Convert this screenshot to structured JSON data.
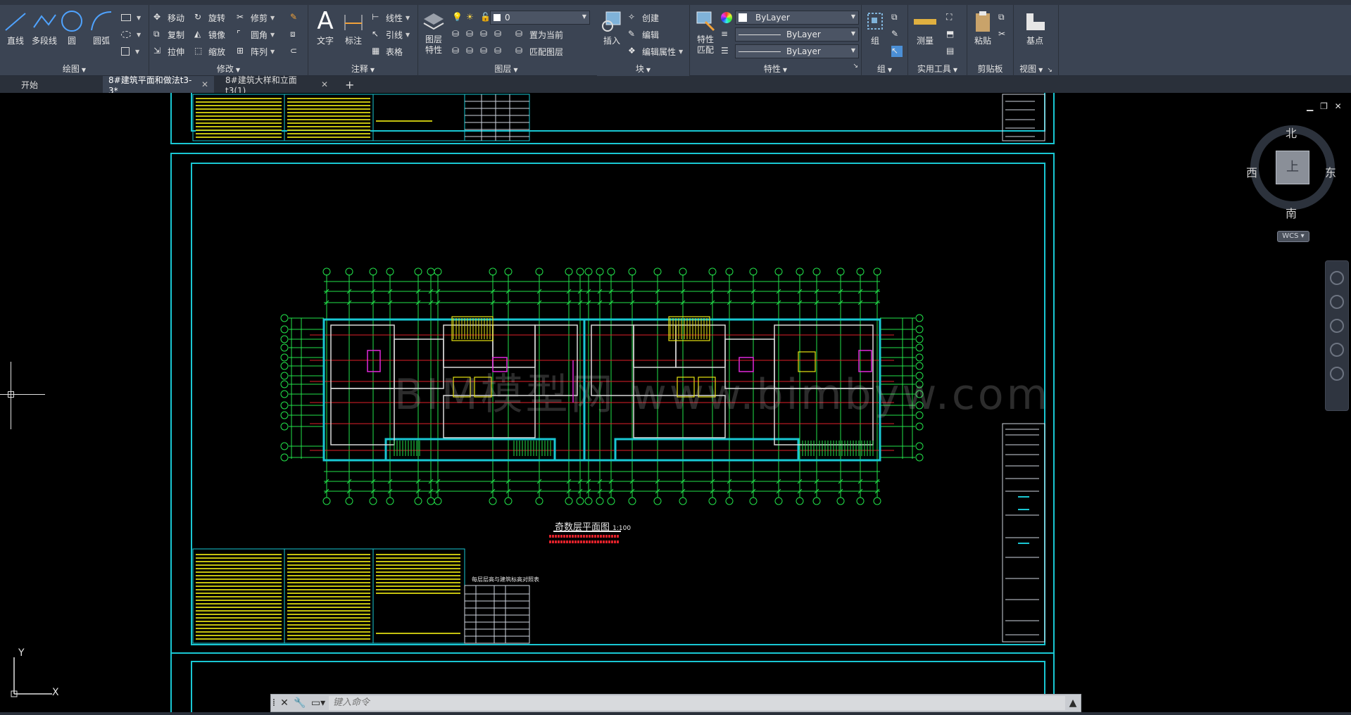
{
  "ribbon": {
    "panels": {
      "draw": {
        "title": "绘图",
        "tools": {
          "line": "直线",
          "polyline": "多段线",
          "circle": "圆",
          "arc": "圆弧"
        }
      },
      "modify": {
        "title": "修改",
        "tools": {
          "move": "移动",
          "rotate": "旋转",
          "trim": "修剪",
          "copy": "复制",
          "mirror": "镜像",
          "fillet": "圆角",
          "stretch": "拉伸",
          "scale": "缩放",
          "array": "阵列"
        }
      },
      "annotation": {
        "title": "注释",
        "tools": {
          "text": "文字",
          "dimension": "标注",
          "linear": "线性",
          "leader": "引线",
          "table": "表格"
        }
      },
      "layers": {
        "title": "图层",
        "tools": {
          "layer_props_line1": "图层",
          "layer_props_line2": "特性",
          "current_layer": "0",
          "set_current": "置为当前",
          "match_layer": "匹配图层"
        }
      },
      "block": {
        "title": "块",
        "tools": {
          "insert": "插入",
          "create": "创建",
          "edit": "编辑",
          "edit_attributes": "编辑属性"
        }
      },
      "properties": {
        "title": "特性",
        "tools": {
          "match_line1": "特性",
          "match_line2": "匹配",
          "color": "ByLayer",
          "linetype": "ByLayer",
          "lineweight": "ByLayer"
        }
      },
      "groups": {
        "title": "组",
        "tools": {
          "group": "组"
        }
      },
      "utilities": {
        "title": "实用工具",
        "tools": {
          "measure": "测量"
        }
      },
      "clipboard": {
        "title": "剪贴板",
        "tools": {
          "paste": "粘贴"
        }
      },
      "view": {
        "title": "视图",
        "tools": {
          "base": "基点"
        }
      }
    }
  },
  "filetabs": {
    "start": "开始",
    "tab1": "8#建筑平面和做法t3-3*",
    "tab2": "8#建筑大样和立面t3(1)",
    "add": "+"
  },
  "drawing": {
    "plan_title": "奇数层平面图",
    "plan_scale": "1:100",
    "watermark": "BIM模型网 www.bimbyw.com",
    "table_title": "每层层高与建筑标高对照表"
  },
  "viewcube": {
    "north": "北",
    "south": "南",
    "east": "东",
    "west": "西",
    "wcs": "WCS"
  },
  "ucs": {
    "x": "X",
    "y": "Y"
  },
  "command": {
    "placeholder": "键入命令"
  },
  "colors": {
    "ribbon_bg": "#3b4453",
    "frame_cyan": "#19c7d3",
    "plan_green": "#22e24a",
    "plan_red": "#e0212a",
    "text_yellow": "#e7e312"
  }
}
